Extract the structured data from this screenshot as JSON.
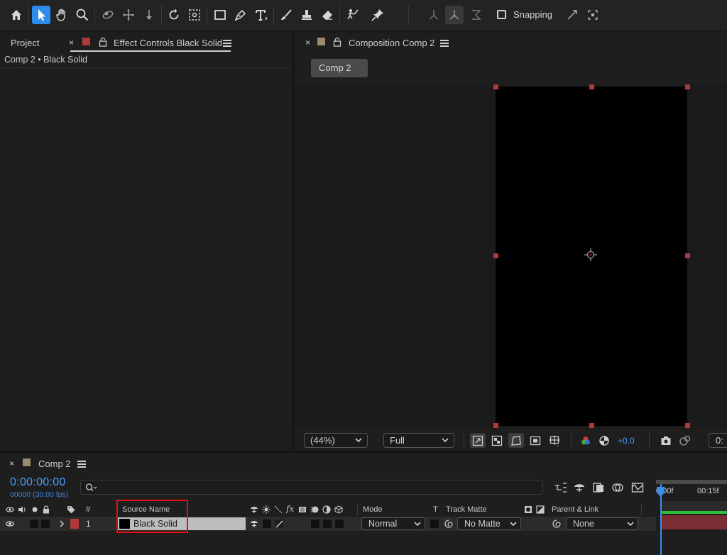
{
  "toolbar": {
    "tools": [
      "home-icon",
      "selection-icon",
      "hand-icon",
      "zoom-icon",
      "orbit-icon",
      "pan-behind-icon",
      "dolly-icon",
      "rotate-icon",
      "anchor-point-icon",
      "rectangle-icon",
      "pen-icon",
      "type-icon",
      "brush-icon",
      "clone-stamp-icon",
      "eraser-icon",
      "roto-brush-icon",
      "puppet-pin-icon"
    ],
    "snapping_label": "Snapping"
  },
  "left_panel": {
    "project_tab": "Project",
    "effect_tab": "Effect Controls Black Solid",
    "effect_swatch_color": "#b03a3a",
    "breadcrumb": "Comp 2 • Black Solid"
  },
  "composition": {
    "tab_label": "Composition Comp 2",
    "swatch_color": "#9c8a6d",
    "comp_chip": "Comp 2",
    "zoom": "(44%)",
    "resolution": "Full",
    "exposure": "+0.0",
    "cutoff_text": "0:"
  },
  "timeline": {
    "tab_label": "Comp 2",
    "swatch_color": "#9c8a6d",
    "timecode": "0:00:00:00",
    "fps": "00000 (30.00 fps)",
    "ruler_labels": [
      "0:00f",
      "00:15f"
    ],
    "columns": {
      "number": "#",
      "source_name": "Source Name",
      "mode": "Mode",
      "t": "T",
      "track_matte": "Track Matte",
      "parent_link": "Parent & Link"
    },
    "layer": {
      "number": "1",
      "name": "Black Solid",
      "label_color": "#b03a3a",
      "mode": "Normal",
      "matte": "No Matte",
      "parent": "None"
    },
    "colors": {
      "accent": "#4a9eff",
      "highlight": "#e01010",
      "track": "#7a2e34",
      "work_area": "#2ebd3a"
    }
  }
}
